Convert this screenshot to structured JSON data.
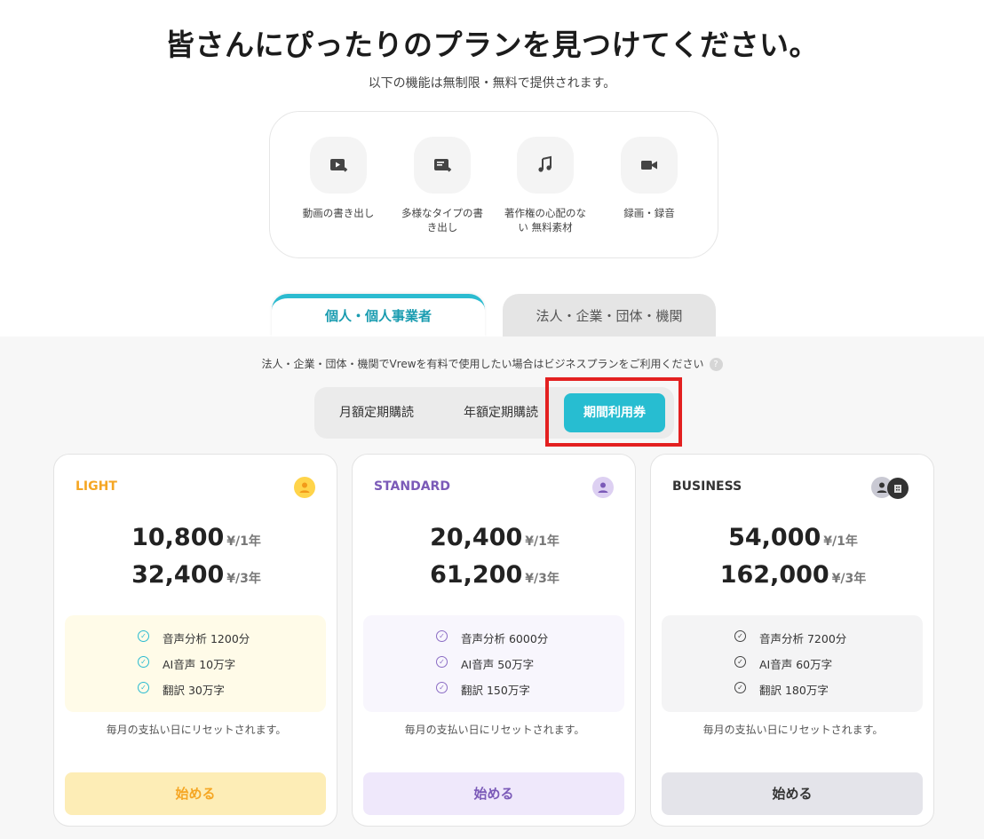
{
  "header": {
    "title": "皆さんにぴったりのプランを見つけてください。",
    "subtitle": "以下の機能は無制限・無料で提供されます。"
  },
  "features": [
    {
      "icon": "video-export-icon",
      "label": "動画の書き出し"
    },
    {
      "icon": "document-export-icon",
      "label": "多様なタイプの書き出し"
    },
    {
      "icon": "music-note-icon",
      "label": "著作権の心配のない 無料素材"
    },
    {
      "icon": "video-camera-icon",
      "label": "録画・録音"
    }
  ],
  "tabs": {
    "personal": "個人・個人事業者",
    "corporate": "法人・企業・団体・機関"
  },
  "notice": {
    "text": "法人・企業・団体・機関でVrewを有料で使用したい場合はビジネスプランをご利用ください",
    "help": "?"
  },
  "period_options": {
    "monthly": "月額定期購読",
    "yearly": "年額定期購読",
    "pass": "期間利用券"
  },
  "plans": [
    {
      "name": "LIGHT",
      "color": "#f5a623",
      "price_1y": "10,800",
      "unit_1y": "¥/1年",
      "price_3y": "32,400",
      "unit_3y": "¥/3年",
      "features": [
        "音声分析 1200分",
        "AI音声 10万字",
        "翻訳 30万字"
      ],
      "reset_note": "毎月の支払い日にリセットされます。",
      "button": "始める"
    },
    {
      "name": "STANDARD",
      "color": "#7b5ab8",
      "price_1y": "20,400",
      "unit_1y": "¥/1年",
      "price_3y": "61,200",
      "unit_3y": "¥/3年",
      "features": [
        "音声分析 6000分",
        "AI音声 50万字",
        "翻訳 150万字"
      ],
      "reset_note": "毎月の支払い日にリセットされます。",
      "button": "始める"
    },
    {
      "name": "BUSINESS",
      "color": "#333333",
      "price_1y": "54,000",
      "unit_1y": "¥/1年",
      "price_3y": "162,000",
      "unit_3y": "¥/3年",
      "features": [
        "音声分析 7200分",
        "AI音声 60万字",
        "翻訳 180万字"
      ],
      "reset_note": "毎月の支払い日にリセットされます。",
      "button": "始める"
    }
  ],
  "colors": {
    "accent": "#27bdd1",
    "highlight_border": "#e32020"
  }
}
